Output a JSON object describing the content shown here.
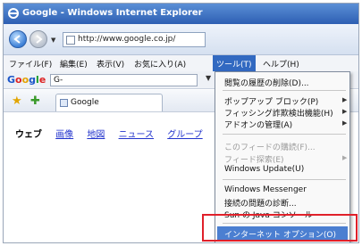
{
  "window": {
    "title": "Google - Windows Internet Explorer"
  },
  "address": {
    "url": "http://www.google.co.jp/"
  },
  "menubar": {
    "items": [
      "ファイル(F)",
      "編集(E)",
      "表示(V)",
      "お気に入り(A)",
      "ツール(T)",
      "ヘルプ(H)"
    ]
  },
  "google_toolbar": {
    "logo": [
      "G",
      "o",
      "o",
      "g",
      "l",
      "e"
    ],
    "search_value": "G-"
  },
  "favorites": {
    "tab_label": "Google"
  },
  "content": {
    "links": [
      "ウェブ",
      "画像",
      "地図",
      "ニュース",
      "グループ"
    ]
  },
  "tools_menu": {
    "items": [
      {
        "label": "閲覧の履歴の削除(D)...",
        "disabled": false,
        "submenu": false
      },
      {
        "label": "ポップアップ ブロック(P)",
        "disabled": false,
        "submenu": true
      },
      {
        "label": "フィッシング詐欺検出機能(H)",
        "disabled": false,
        "submenu": true
      },
      {
        "label": "アドオンの管理(A)",
        "disabled": false,
        "submenu": true
      },
      {
        "label": "このフィードの購読(F)...",
        "disabled": true,
        "submenu": false
      },
      {
        "label": "フィード探索(E)",
        "disabled": true,
        "submenu": true
      },
      {
        "label": "Windows Update(U)",
        "disabled": false,
        "submenu": false
      },
      {
        "label": "Windows Messenger",
        "disabled": false,
        "submenu": false
      },
      {
        "label": "接続の問題の診断...",
        "disabled": false,
        "submenu": false
      },
      {
        "label": "Sun の Java コンソール",
        "disabled": false,
        "submenu": false
      },
      {
        "label": "インターネット オプション(O)",
        "disabled": false,
        "submenu": false,
        "highlighted": true
      }
    ]
  },
  "colors": {
    "highlight": "#4b7fd1",
    "callout_border": "#e0202a"
  }
}
